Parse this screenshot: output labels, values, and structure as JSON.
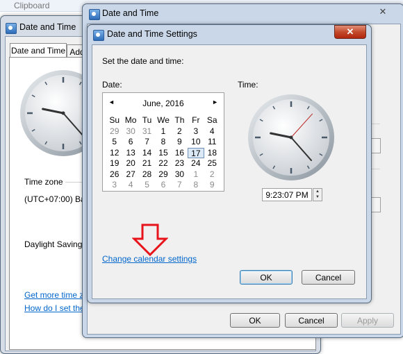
{
  "ribbon": {
    "label": "Clipboard"
  },
  "back_window": {
    "title": "Date and Time",
    "tabs": [
      "Date and Time",
      "Add"
    ]
  },
  "back_content": {
    "time_zone_label": "Time zone",
    "time_zone_value": "(UTC+07:00) Ba",
    "daylight_label": "Daylight Saving",
    "link_more": "Get more time z",
    "link_howto": "How do I set the"
  },
  "mid_window": {
    "title": "Date and Time",
    "ok_label": "OK",
    "cancel_label": "Cancel",
    "apply_label": "Apply"
  },
  "dialog": {
    "title": "Date and Time Settings",
    "prompt": "Set the date and time:",
    "date_label": "Date:",
    "time_label": "Time:",
    "time_value": "9:23:07 PM",
    "change_calendar_link": "Change calendar settings",
    "ok_label": "OK",
    "cancel_label": "Cancel"
  },
  "calendar": {
    "month_label": "June, 2016",
    "prev_icon": "◄",
    "next_icon": "►",
    "weekdays": [
      "Su",
      "Mo",
      "Tu",
      "We",
      "Th",
      "Fr",
      "Sa"
    ],
    "weeks": [
      [
        "29",
        "30",
        "31",
        "1",
        "2",
        "3",
        "4"
      ],
      [
        "5",
        "6",
        "7",
        "8",
        "9",
        "10",
        "11"
      ],
      [
        "12",
        "13",
        "14",
        "15",
        "16",
        "17",
        "18"
      ],
      [
        "19",
        "20",
        "21",
        "22",
        "23",
        "24",
        "25"
      ],
      [
        "26",
        "27",
        "28",
        "29",
        "30",
        "1",
        "2"
      ],
      [
        "3",
        "4",
        "5",
        "6",
        "7",
        "8",
        "9"
      ]
    ],
    "selected_day": "17"
  },
  "clock": {
    "hour": 9,
    "minute": 23,
    "second": 7
  },
  "annotation": {
    "icon": "down-arrow-icon",
    "color": "#e8141b"
  },
  "close_glyph": "✕"
}
